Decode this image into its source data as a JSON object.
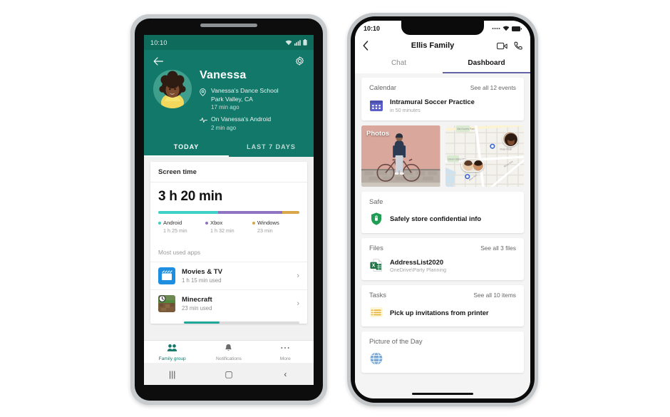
{
  "android": {
    "status_bar": {
      "time": "10:10",
      "icons": [
        "wifi-icon",
        "signal-icon",
        "battery-icon"
      ]
    },
    "header": {
      "back_icon": "back-arrow-icon",
      "settings_icon": "gear-icon",
      "name": "Vanessa",
      "location": {
        "icon": "location-pin-icon",
        "line1": "Vanessa's Dance School",
        "line2": "Park Valley, CA",
        "time": "17 min ago"
      },
      "activity": {
        "icon": "activity-pulse-icon",
        "line1": "On Vanessa's Android",
        "time": "2 min ago"
      },
      "bg_color": "#12796a"
    },
    "tabs": [
      {
        "label": "TODAY",
        "active": true
      },
      {
        "label": "LAST 7 DAYS",
        "active": false
      }
    ],
    "screen_time": {
      "card_title": "Screen time",
      "total": "3 h 20 min",
      "segments": [
        {
          "name": "Android",
          "value": "1 h 25 min",
          "color": "#3ecfc7",
          "pct": 42.5
        },
        {
          "name": "Xbox",
          "value": "1 h 32 min",
          "color": "#8e73c0",
          "pct": 45.5
        },
        {
          "name": "Windows",
          "value": "23 min",
          "color": "#d9a648",
          "pct": 12
        }
      ]
    },
    "most_used": {
      "heading": "Most used apps",
      "apps": [
        {
          "name": "Movies & TV",
          "usage": "1 h 15 min used",
          "icon": "movies-tv-icon",
          "progress": null
        },
        {
          "name": "Minecraft",
          "usage": "23 min used",
          "icon": "minecraft-icon",
          "progress": 31
        }
      ],
      "chevron": "chevron-right-icon"
    },
    "bottom_nav": [
      {
        "label": "Family group",
        "icon": "family-group-icon",
        "active": true
      },
      {
        "label": "Notifications",
        "icon": "bell-icon",
        "active": false
      },
      {
        "label": "More",
        "icon": "more-dots-icon",
        "active": false
      }
    ],
    "system_nav": [
      {
        "icon": "recents-icon",
        "glyph": "|||"
      },
      {
        "icon": "home-icon",
        "glyph": "▢"
      },
      {
        "icon": "back-icon",
        "glyph": "‹"
      }
    ]
  },
  "ios": {
    "status_bar": {
      "time": "10:10",
      "icons": [
        "cellular-dots-icon",
        "wifi-icon",
        "battery-icon"
      ]
    },
    "header": {
      "back_icon": "chevron-left-icon",
      "title": "Ellis Family",
      "video_icon": "video-call-icon",
      "phone_icon": "phone-call-icon"
    },
    "tabs": [
      {
        "label": "Chat",
        "active": false
      },
      {
        "label": "Dashboard",
        "active": true
      }
    ],
    "accent_color": "#6264a7",
    "cards": {
      "calendar": {
        "title": "Calendar",
        "link": "See all 12 events",
        "item_icon": "calendar-icon",
        "item_title": "Intramural Soccer Practice",
        "item_sub": "in 50 minutes"
      },
      "photos": {
        "label": "Photos",
        "alt": "person-with-bicycle-photo"
      },
      "map": {
        "alt": "location-map-tile",
        "pins": [
          "avatar-pin-vanessa",
          "avatar-pin-two-people"
        ]
      },
      "safe": {
        "title": "Safe",
        "item_icon": "shield-lock-icon",
        "item_title": "Safely store confidential info"
      },
      "files": {
        "title": "Files",
        "link": "See all 3 files",
        "item_icon": "excel-file-icon",
        "item_title": "AddressList2020",
        "item_sub": "OneDrive\\Party Planning"
      },
      "tasks": {
        "title": "Tasks",
        "link": "See all 10 items",
        "item_icon": "tasks-list-icon",
        "item_title": "Pick up invitations from printer"
      },
      "picture_of_day": {
        "title": "Picture of the Day",
        "item_icon": "globe-icon"
      }
    }
  }
}
